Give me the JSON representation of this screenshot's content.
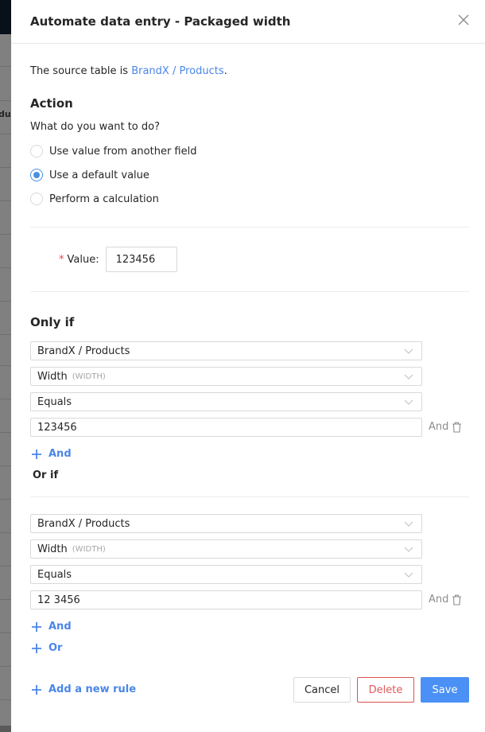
{
  "background": {
    "partial_text": "du"
  },
  "drawer": {
    "title": "Automate data entry - Packaged width",
    "close_icon": "close-icon",
    "source_prefix": "The source table is ",
    "source_link": "BrandX / Products",
    "source_suffix": "."
  },
  "action": {
    "heading": "Action",
    "question": "What do you want to do?",
    "options": [
      {
        "label": "Use value from another field",
        "checked": false
      },
      {
        "label": "Use a default value",
        "checked": true
      },
      {
        "label": "Perform a calculation",
        "checked": false
      }
    ],
    "value_label": "Value",
    "value_colon": ":",
    "required_mark": "*",
    "value": "123456"
  },
  "only_if": {
    "heading": "Only if",
    "groups": [
      {
        "table": "BrandX / Products",
        "field": "Width",
        "field_code": "(WIDTH)",
        "operator": "Equals",
        "value": "123456",
        "and_label": "And"
      },
      {
        "table": "BrandX / Products",
        "field": "Width",
        "field_code": "(WIDTH)",
        "operator": "Equals",
        "value": "12 3456",
        "and_label": "And"
      }
    ],
    "add_and_label": "And",
    "or_if_label": "Or if",
    "add_or_label": "Or"
  },
  "footer": {
    "add_rule_label": "Add a new rule",
    "cancel_label": "Cancel",
    "delete_label": "Delete",
    "save_label": "Save"
  },
  "colors": {
    "accent": "#4a90f5",
    "link": "#4a86e8",
    "danger": "#e05a5a",
    "required": "#e0474c"
  }
}
